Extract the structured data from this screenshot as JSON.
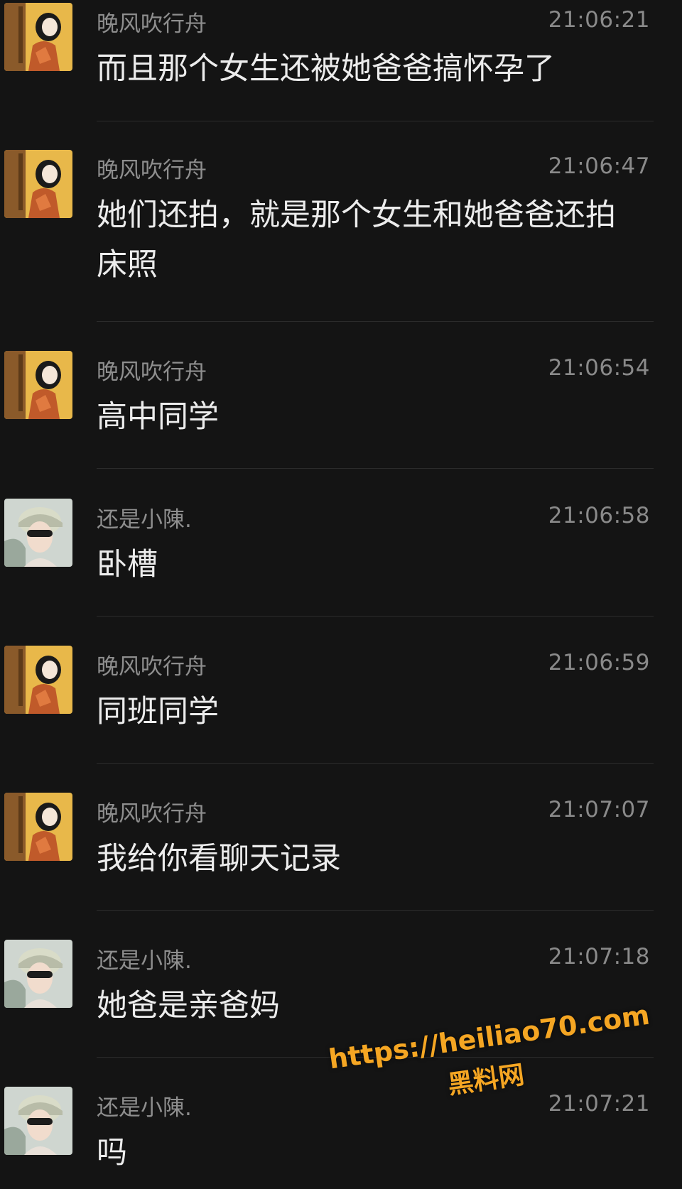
{
  "messages": [
    {
      "sender": "晚风吹行舟",
      "time": "21:06:21",
      "text": "而且那个女生还被她爸爸搞怀孕了",
      "avatar": "avatar-wanfeng"
    },
    {
      "sender": "晚风吹行舟",
      "time": "21:06:47",
      "text": "她们还拍，就是那个女生和她爸爸还拍床照",
      "avatar": "avatar-wanfeng"
    },
    {
      "sender": "晚风吹行舟",
      "time": "21:06:54",
      "text": "高中同学",
      "avatar": "avatar-wanfeng"
    },
    {
      "sender": "还是小陳.",
      "time": "21:06:58",
      "text": "卧槽",
      "avatar": "avatar-xiaochen"
    },
    {
      "sender": "晚风吹行舟",
      "time": "21:06:59",
      "text": "同班同学",
      "avatar": "avatar-wanfeng"
    },
    {
      "sender": "晚风吹行舟",
      "time": "21:07:07",
      "text": "我给你看聊天记录",
      "avatar": "avatar-wanfeng"
    },
    {
      "sender": "还是小陳.",
      "time": "21:07:18",
      "text": "她爸是亲爸妈",
      "avatar": "avatar-xiaochen"
    },
    {
      "sender": "还是小陳.",
      "time": "21:07:21",
      "text": "吗",
      "avatar": "avatar-xiaochen"
    }
  ],
  "watermark": {
    "url": "https://heiliao70.com",
    "site": "黑料网"
  },
  "colors": {
    "background": "#141414",
    "sender": "#8e8e8e",
    "time": "#8a8a8a",
    "text": "#ececec",
    "divider": "#2c2c2c",
    "watermark": "#f5a623"
  }
}
